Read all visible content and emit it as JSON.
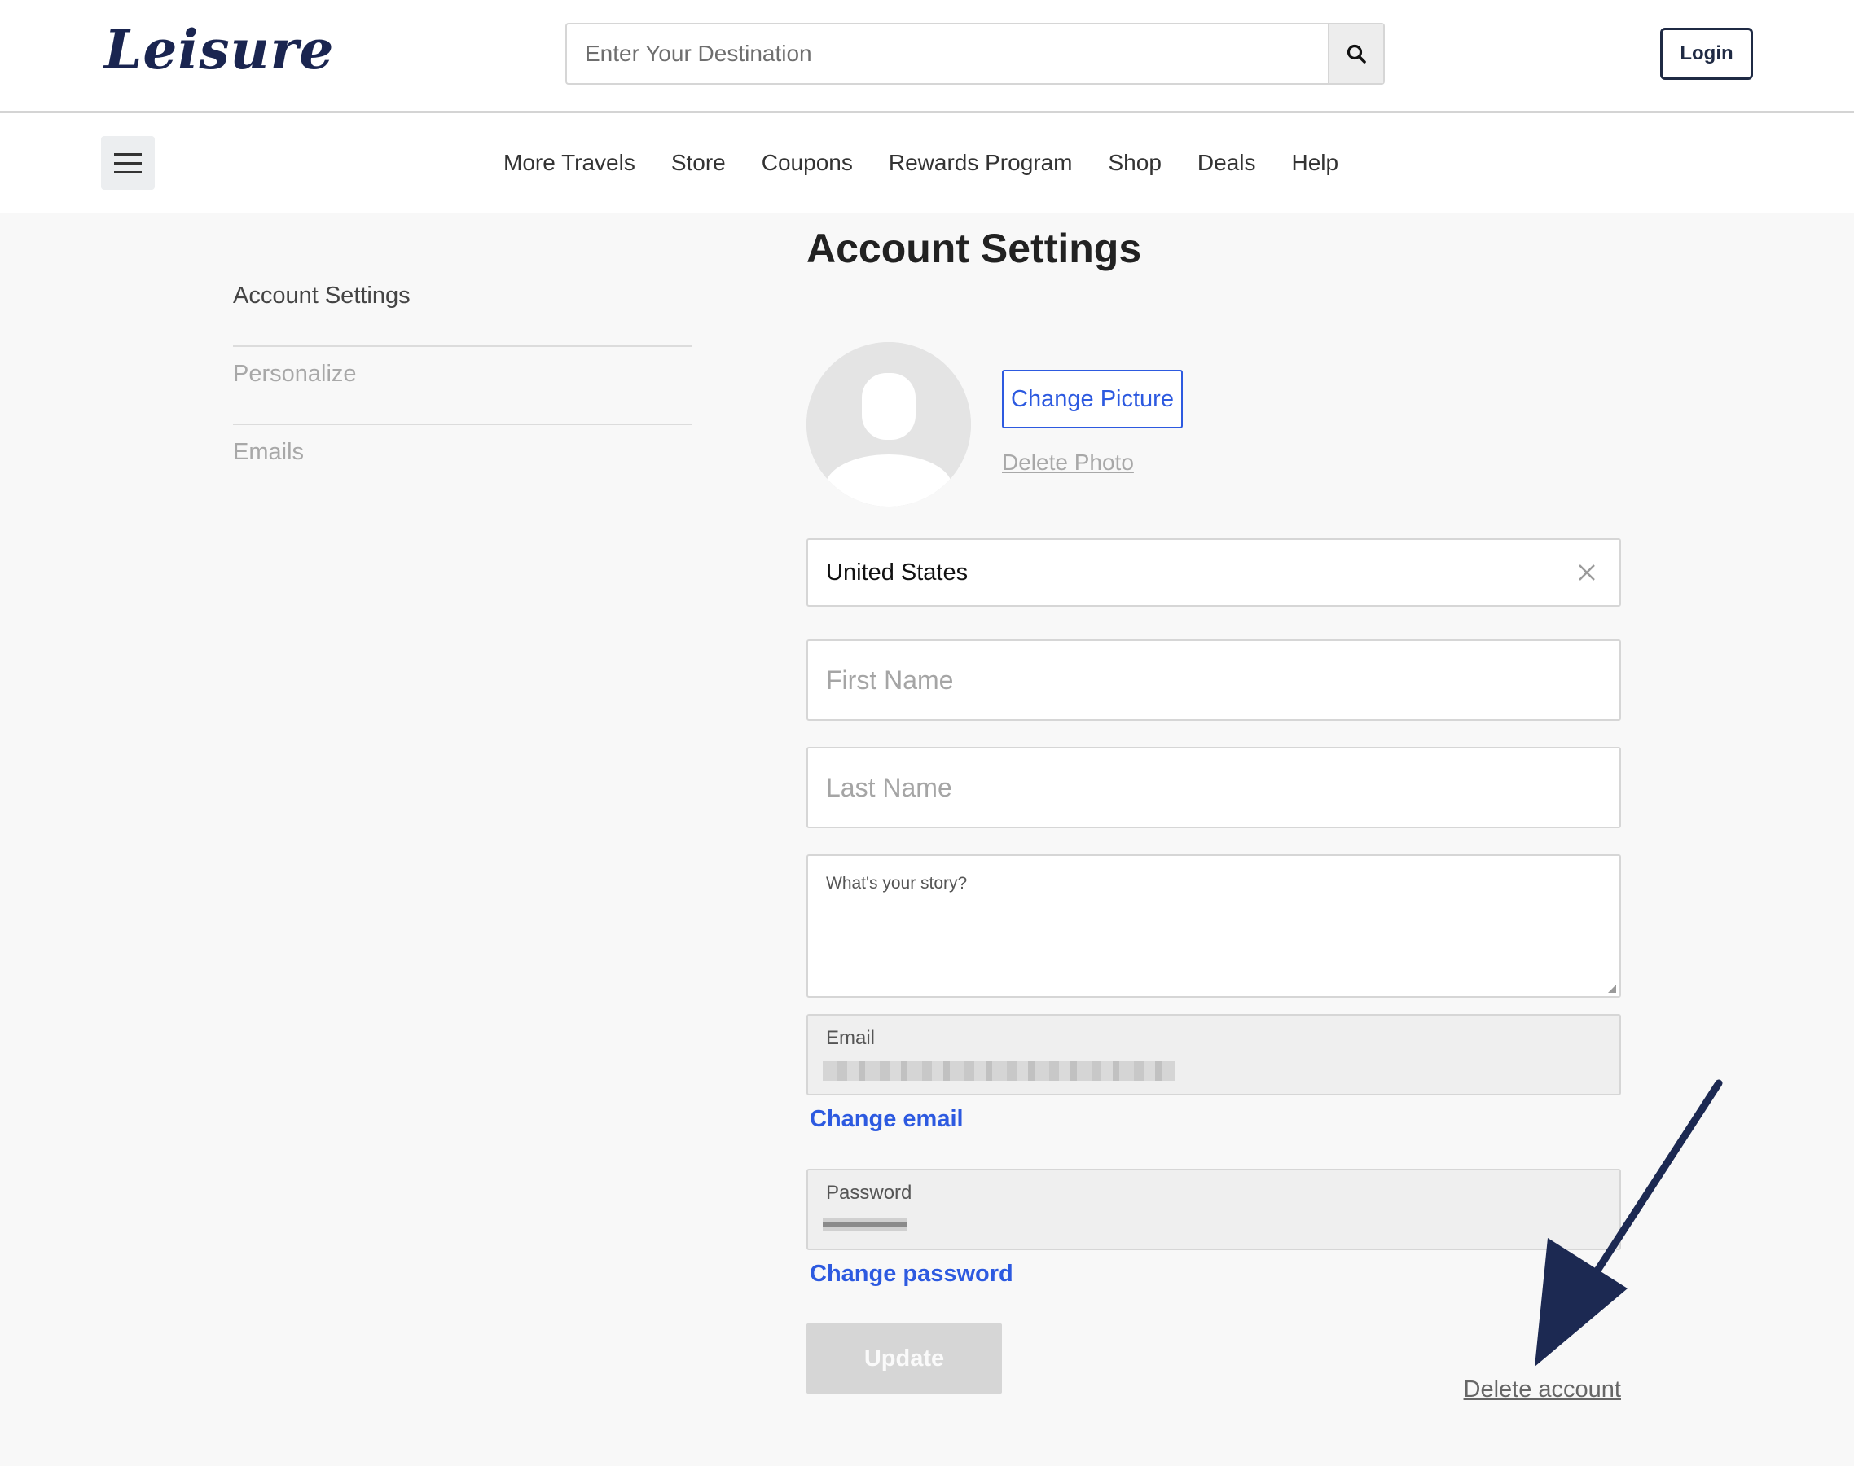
{
  "header": {
    "logo_text": "Leisure",
    "search": {
      "placeholder": "Enter Your Destination",
      "icon": "search-icon"
    },
    "login_label": "Login"
  },
  "nav": {
    "menu_icon": "hamburger-menu-icon",
    "links": [
      "More Travels",
      "Store",
      "Coupons",
      "Rewards Program",
      "Shop",
      "Deals",
      "Help"
    ]
  },
  "sidebar": {
    "items": [
      {
        "label": "Account Settings",
        "active": true
      },
      {
        "label": "Personalize",
        "active": false
      },
      {
        "label": "Emails",
        "active": false
      }
    ]
  },
  "main": {
    "title": "Account Settings",
    "avatar_icon": "default-user-avatar-icon",
    "change_picture_label": "Change Picture",
    "delete_photo_label": "Delete Photo",
    "country": {
      "value": "United States",
      "clear_icon": "close-icon"
    },
    "first_name_placeholder": "First Name",
    "last_name_placeholder": "Last Name",
    "story_placeholder": "What's your story?",
    "email_label": "Email",
    "change_email_label": "Change email",
    "password_label": "Password",
    "change_password_label": "Change password",
    "update_label": "Update",
    "delete_account_label": "Delete account"
  },
  "colors": {
    "brand_navy": "#1a2550",
    "link_blue": "#2d5ae0",
    "annotation_arrow": "#1c2952",
    "page_bg": "#f8f8f8"
  }
}
